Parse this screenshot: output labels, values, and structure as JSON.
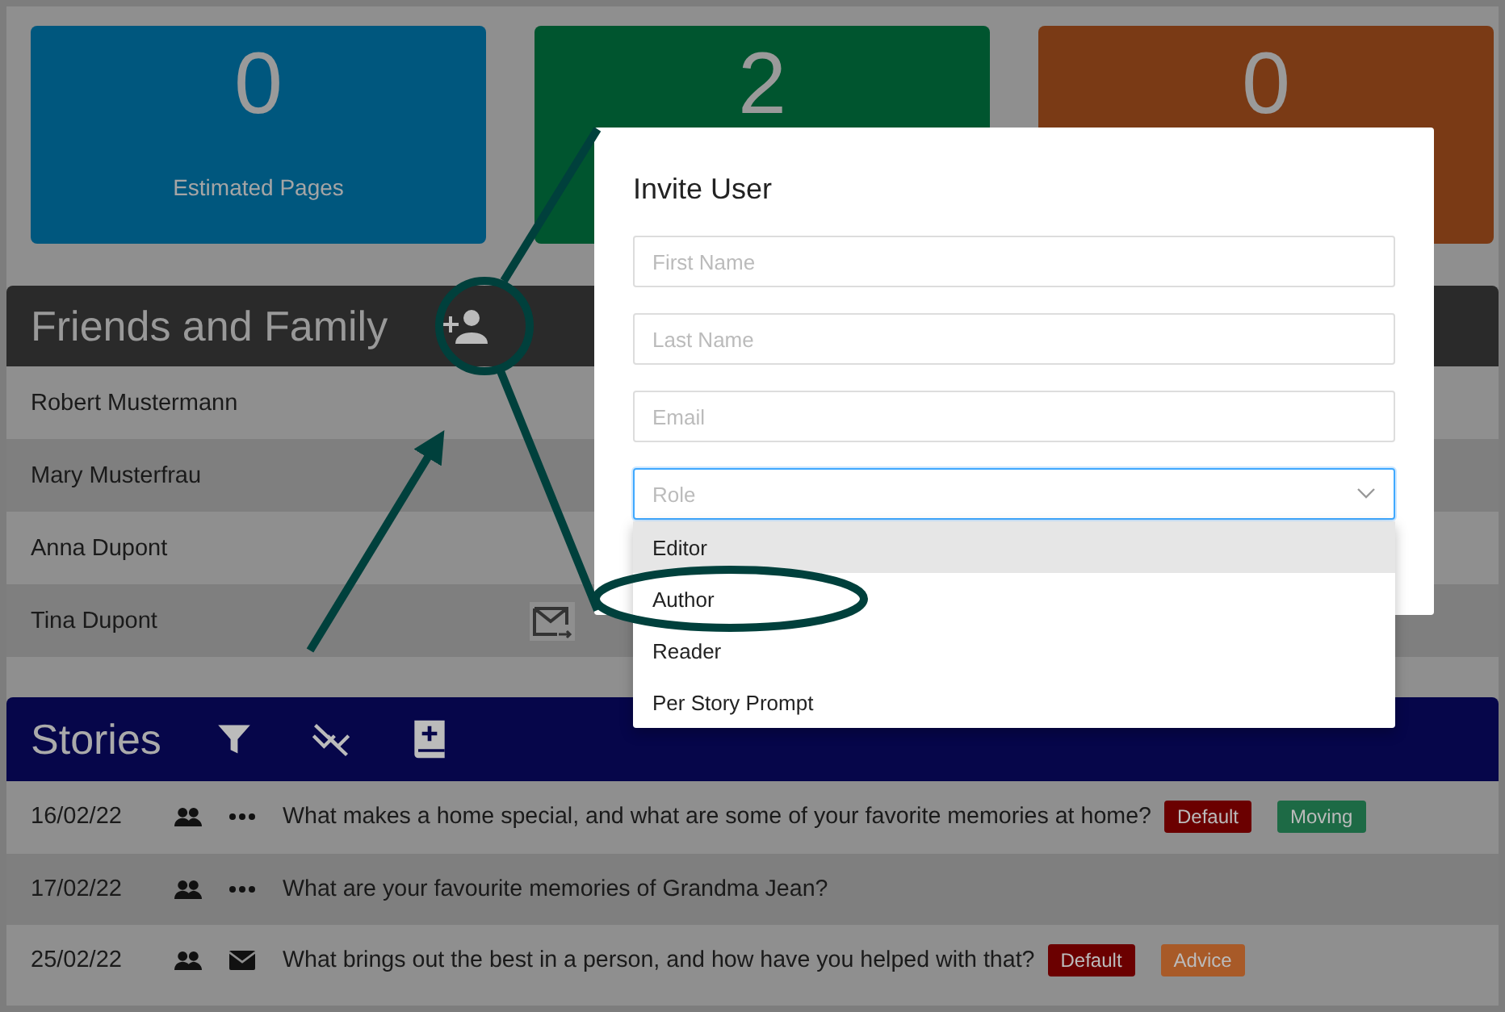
{
  "stats": [
    {
      "value": "0",
      "label": "Estimated Pages",
      "color": "#00577e"
    },
    {
      "value": "2",
      "color": "#00552f"
    },
    {
      "value": "0",
      "color": "#7a3a15"
    }
  ],
  "friends": {
    "title": "Friends and Family",
    "rows": [
      {
        "name": "Robert Mustermann",
        "invite_icon": false
      },
      {
        "name": "Mary Musterfrau",
        "invite_icon": false
      },
      {
        "name": "Anna Dupont",
        "invite_icon": false
      },
      {
        "name": "Tina Dupont",
        "invite_icon": true
      }
    ]
  },
  "stories": {
    "title": "Stories",
    "rows": [
      {
        "date": "16/02/22",
        "kind": "dots",
        "question": "What makes a home special, and what are some of your favorite memories at home?",
        "tags": [
          {
            "label": "Default",
            "color": "#6b0000"
          },
          {
            "label": "Moving",
            "color": "#1d6a45"
          }
        ]
      },
      {
        "date": "17/02/22",
        "kind": "dots",
        "question": "What are your favourite memories of Grandma Jean?"
      },
      {
        "date": "25/02/22",
        "kind": "mail",
        "question": "What brings out the best in a person, and how have you helped with that?",
        "tags": [
          {
            "label": "Default",
            "color": "#6b0000"
          },
          {
            "label": "Advice",
            "color": "#a85a28"
          }
        ]
      }
    ]
  },
  "dialog": {
    "title": "Invite User",
    "fields": [
      {
        "placeholder": "First Name"
      },
      {
        "placeholder": "Last Name"
      },
      {
        "placeholder": "Email"
      }
    ],
    "role": {
      "placeholder": "Role",
      "options": [
        {
          "label": "Editor",
          "highlighted": true
        },
        {
          "label": "Author",
          "highlighted": false
        },
        {
          "label": "Reader",
          "highlighted": false
        },
        {
          "label": "Per Story Prompt",
          "highlighted": false
        }
      ]
    }
  }
}
